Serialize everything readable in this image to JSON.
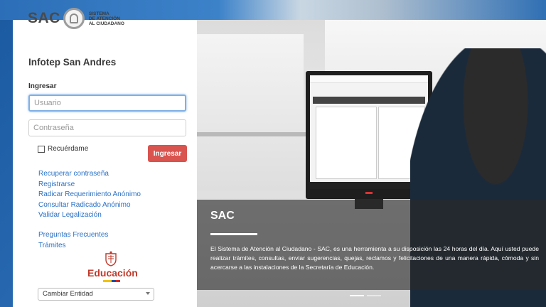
{
  "brand": {
    "name": "SAC",
    "subtitle": "SISTEMA\nDE ATENCIÓN\nAL CIUDADANO"
  },
  "entity_title": "Infotep San Andres",
  "login": {
    "heading": "Ingresar",
    "username_placeholder": "Usuario",
    "password_placeholder": "Contraseña",
    "remember_label": "Recuérdame",
    "submit_label": "Ingresar"
  },
  "links": {
    "primary": [
      "Recuperar contraseña",
      "Registrarse",
      "Radicar Requerimiento Anónimo",
      "Consultar Radicado Anónimo",
      "Validar Legalización"
    ],
    "secondary": [
      "Preguntas Frecuentes",
      "Trámites"
    ]
  },
  "education_logo": {
    "label": "Educación"
  },
  "entity_select": {
    "selected": "Cambiar Entidad"
  },
  "hero": {
    "title": "SAC",
    "text": "El Sistema de Atención al Ciudadano - SAC, es una herramienta a su disposición las 24 horas del día. Aquí usted puede realizar trámites, consultas, enviar sugerencias, quejas, reclamos y felicitaciones de una manera rápida, cómoda y sin acercarse a las instalaciones de la Secretaría de Educación."
  },
  "colors": {
    "accent_button": "#d9534f",
    "link": "#2a72c7",
    "education": "#c0392b"
  }
}
